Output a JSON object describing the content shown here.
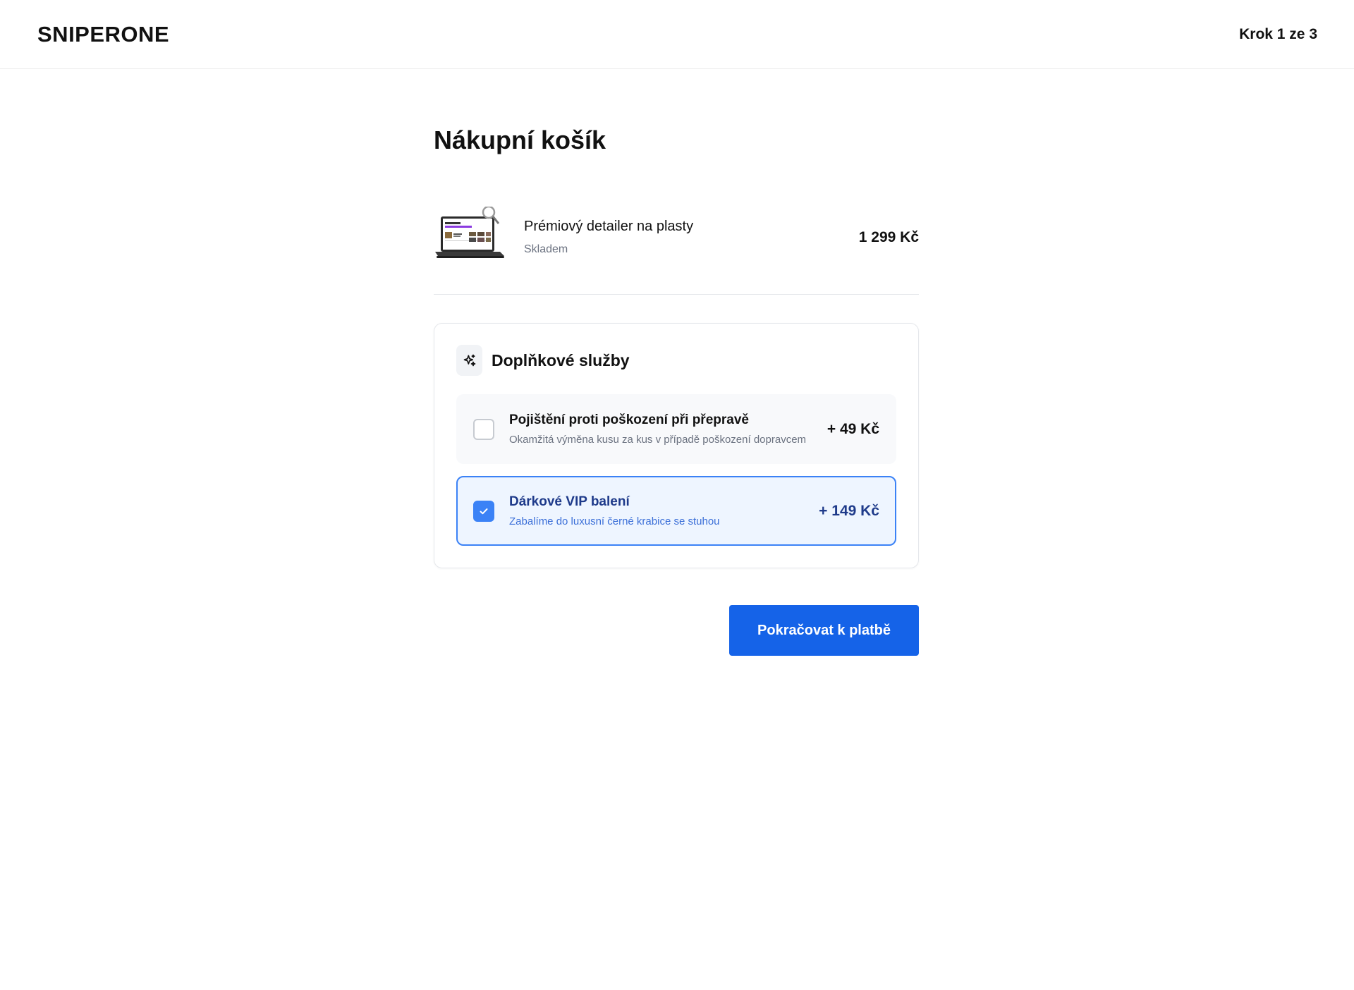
{
  "header": {
    "logo": "SNIPERONE",
    "step": "Krok 1 ze 3"
  },
  "cart": {
    "title": "Nákupní košík",
    "item": {
      "name": "Prémiový detailer na plasty",
      "stock": "Skladem",
      "price": "1 299 Kč",
      "image_icon": "laptop-product-image"
    }
  },
  "addons": {
    "title": "Doplňkové služby",
    "icon": "sparkle-icon",
    "options": [
      {
        "name": "Pojištění proti poškození při přepravě",
        "description": "Okamžitá výměna kusu za kus v případě poškození dopravcem",
        "price": "+ 49 Kč",
        "checked": false
      },
      {
        "name": "Dárkové VIP balení",
        "description": "Zabalíme do luxusní černé krabice se stuhou",
        "price": "+ 149 Kč",
        "checked": true
      }
    ]
  },
  "actions": {
    "continue_label": "Pokračovat k platbě"
  },
  "colors": {
    "accent": "#1563e8",
    "selected_border": "#3b82f6",
    "selected_bg": "#eef5ff"
  }
}
